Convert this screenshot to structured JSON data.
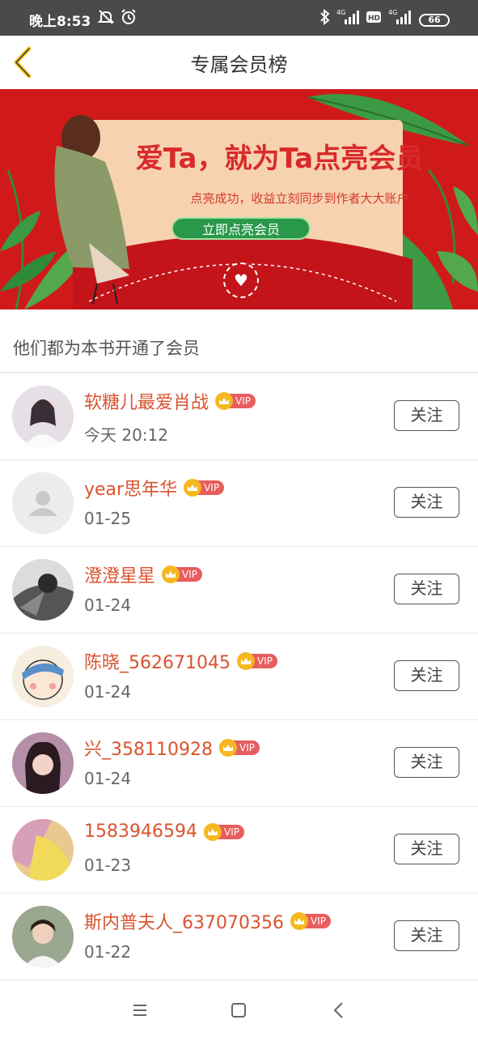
{
  "status_bar": {
    "time": "晚上8:53",
    "battery": "66",
    "icons": [
      "mute-icon",
      "alarm-icon",
      "bluetooth-icon",
      "signal-4g-icon",
      "hd-icon",
      "signal-4g-icon"
    ]
  },
  "header": {
    "title": "专属会员榜",
    "back_icon": "chevron-left-icon"
  },
  "banner": {
    "title": "爱Ta，就为Ta点亮会员",
    "subtitle": "点亮成功，收益立刻同步到作者大大账户",
    "button": "立即点亮会员",
    "colors": {
      "background": "#d01a1a",
      "card": "#f7d2b0",
      "button": "#29984a"
    }
  },
  "section": {
    "title": "他们都为本书开通了会员"
  },
  "vip_label": "VIP",
  "follow_label": "关注",
  "members": [
    {
      "name": "软糖儿最爱肖战",
      "date": "今天 20:12",
      "avatar": "avatar-photo-girl"
    },
    {
      "name": "year思年华",
      "date": "01-25",
      "avatar": "avatar-default"
    },
    {
      "name": "澄澄星星",
      "date": "01-24",
      "avatar": "avatar-photo-dark"
    },
    {
      "name": "陈晓_562671045",
      "date": "01-24",
      "avatar": "avatar-cartoon"
    },
    {
      "name": "兴_358110928",
      "date": "01-24",
      "avatar": "avatar-photo-girl2"
    },
    {
      "name": "1583946594",
      "date": "01-23",
      "avatar": "avatar-yellow"
    },
    {
      "name": "斯内普夫人_637070356",
      "date": "01-22",
      "avatar": "avatar-photo-girl3"
    }
  ],
  "nav": {
    "icons": [
      "menu-icon",
      "home-square-icon",
      "back-triangle-icon"
    ]
  },
  "colors": {
    "name": "#d9532f",
    "vip_badge": "#e85d5d",
    "crown": "#f5b820"
  }
}
